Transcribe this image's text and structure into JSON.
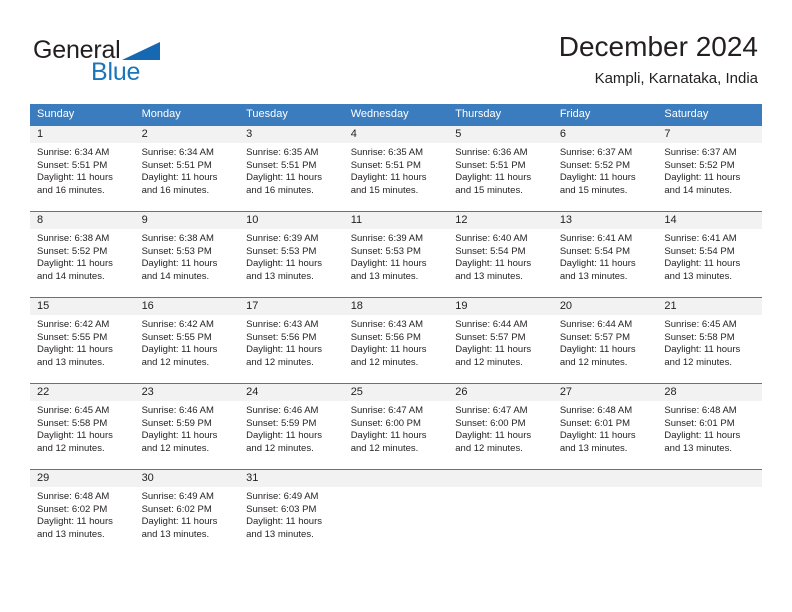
{
  "brand": {
    "word_one": "General",
    "word_two": "Blue",
    "triangle_color": "#1668b3",
    "blue_text_color": "#1b75bb"
  },
  "header": {
    "title": "December 2024",
    "subtitle": "Kampli, Karnataka, India"
  },
  "theme": {
    "header_row_bg": "#3a7cbe",
    "header_row_text": "#ffffff",
    "day_band_bg": "#f2f2f2",
    "cell_text": "#231f20"
  },
  "weekday_headers": [
    "Sunday",
    "Monday",
    "Tuesday",
    "Wednesday",
    "Thursday",
    "Friday",
    "Saturday"
  ],
  "weeks": [
    {
      "days": [
        {
          "date": "1",
          "sunrise": "Sunrise: 6:34 AM",
          "sunset": "Sunset: 5:51 PM",
          "daylight_line1": "Daylight: 11 hours",
          "daylight_line2": "and 16 minutes."
        },
        {
          "date": "2",
          "sunrise": "Sunrise: 6:34 AM",
          "sunset": "Sunset: 5:51 PM",
          "daylight_line1": "Daylight: 11 hours",
          "daylight_line2": "and 16 minutes."
        },
        {
          "date": "3",
          "sunrise": "Sunrise: 6:35 AM",
          "sunset": "Sunset: 5:51 PM",
          "daylight_line1": "Daylight: 11 hours",
          "daylight_line2": "and 16 minutes."
        },
        {
          "date": "4",
          "sunrise": "Sunrise: 6:35 AM",
          "sunset": "Sunset: 5:51 PM",
          "daylight_line1": "Daylight: 11 hours",
          "daylight_line2": "and 15 minutes."
        },
        {
          "date": "5",
          "sunrise": "Sunrise: 6:36 AM",
          "sunset": "Sunset: 5:51 PM",
          "daylight_line1": "Daylight: 11 hours",
          "daylight_line2": "and 15 minutes."
        },
        {
          "date": "6",
          "sunrise": "Sunrise: 6:37 AM",
          "sunset": "Sunset: 5:52 PM",
          "daylight_line1": "Daylight: 11 hours",
          "daylight_line2": "and 15 minutes."
        },
        {
          "date": "7",
          "sunrise": "Sunrise: 6:37 AM",
          "sunset": "Sunset: 5:52 PM",
          "daylight_line1": "Daylight: 11 hours",
          "daylight_line2": "and 14 minutes."
        }
      ]
    },
    {
      "days": [
        {
          "date": "8",
          "sunrise": "Sunrise: 6:38 AM",
          "sunset": "Sunset: 5:52 PM",
          "daylight_line1": "Daylight: 11 hours",
          "daylight_line2": "and 14 minutes."
        },
        {
          "date": "9",
          "sunrise": "Sunrise: 6:38 AM",
          "sunset": "Sunset: 5:53 PM",
          "daylight_line1": "Daylight: 11 hours",
          "daylight_line2": "and 14 minutes."
        },
        {
          "date": "10",
          "sunrise": "Sunrise: 6:39 AM",
          "sunset": "Sunset: 5:53 PM",
          "daylight_line1": "Daylight: 11 hours",
          "daylight_line2": "and 13 minutes."
        },
        {
          "date": "11",
          "sunrise": "Sunrise: 6:39 AM",
          "sunset": "Sunset: 5:53 PM",
          "daylight_line1": "Daylight: 11 hours",
          "daylight_line2": "and 13 minutes."
        },
        {
          "date": "12",
          "sunrise": "Sunrise: 6:40 AM",
          "sunset": "Sunset: 5:54 PM",
          "daylight_line1": "Daylight: 11 hours",
          "daylight_line2": "and 13 minutes."
        },
        {
          "date": "13",
          "sunrise": "Sunrise: 6:41 AM",
          "sunset": "Sunset: 5:54 PM",
          "daylight_line1": "Daylight: 11 hours",
          "daylight_line2": "and 13 minutes."
        },
        {
          "date": "14",
          "sunrise": "Sunrise: 6:41 AM",
          "sunset": "Sunset: 5:54 PM",
          "daylight_line1": "Daylight: 11 hours",
          "daylight_line2": "and 13 minutes."
        }
      ]
    },
    {
      "days": [
        {
          "date": "15",
          "sunrise": "Sunrise: 6:42 AM",
          "sunset": "Sunset: 5:55 PM",
          "daylight_line1": "Daylight: 11 hours",
          "daylight_line2": "and 13 minutes."
        },
        {
          "date": "16",
          "sunrise": "Sunrise: 6:42 AM",
          "sunset": "Sunset: 5:55 PM",
          "daylight_line1": "Daylight: 11 hours",
          "daylight_line2": "and 12 minutes."
        },
        {
          "date": "17",
          "sunrise": "Sunrise: 6:43 AM",
          "sunset": "Sunset: 5:56 PM",
          "daylight_line1": "Daylight: 11 hours",
          "daylight_line2": "and 12 minutes."
        },
        {
          "date": "18",
          "sunrise": "Sunrise: 6:43 AM",
          "sunset": "Sunset: 5:56 PM",
          "daylight_line1": "Daylight: 11 hours",
          "daylight_line2": "and 12 minutes."
        },
        {
          "date": "19",
          "sunrise": "Sunrise: 6:44 AM",
          "sunset": "Sunset: 5:57 PM",
          "daylight_line1": "Daylight: 11 hours",
          "daylight_line2": "and 12 minutes."
        },
        {
          "date": "20",
          "sunrise": "Sunrise: 6:44 AM",
          "sunset": "Sunset: 5:57 PM",
          "daylight_line1": "Daylight: 11 hours",
          "daylight_line2": "and 12 minutes."
        },
        {
          "date": "21",
          "sunrise": "Sunrise: 6:45 AM",
          "sunset": "Sunset: 5:58 PM",
          "daylight_line1": "Daylight: 11 hours",
          "daylight_line2": "and 12 minutes."
        }
      ]
    },
    {
      "days": [
        {
          "date": "22",
          "sunrise": "Sunrise: 6:45 AM",
          "sunset": "Sunset: 5:58 PM",
          "daylight_line1": "Daylight: 11 hours",
          "daylight_line2": "and 12 minutes."
        },
        {
          "date": "23",
          "sunrise": "Sunrise: 6:46 AM",
          "sunset": "Sunset: 5:59 PM",
          "daylight_line1": "Daylight: 11 hours",
          "daylight_line2": "and 12 minutes."
        },
        {
          "date": "24",
          "sunrise": "Sunrise: 6:46 AM",
          "sunset": "Sunset: 5:59 PM",
          "daylight_line1": "Daylight: 11 hours",
          "daylight_line2": "and 12 minutes."
        },
        {
          "date": "25",
          "sunrise": "Sunrise: 6:47 AM",
          "sunset": "Sunset: 6:00 PM",
          "daylight_line1": "Daylight: 11 hours",
          "daylight_line2": "and 12 minutes."
        },
        {
          "date": "26",
          "sunrise": "Sunrise: 6:47 AM",
          "sunset": "Sunset: 6:00 PM",
          "daylight_line1": "Daylight: 11 hours",
          "daylight_line2": "and 12 minutes."
        },
        {
          "date": "27",
          "sunrise": "Sunrise: 6:48 AM",
          "sunset": "Sunset: 6:01 PM",
          "daylight_line1": "Daylight: 11 hours",
          "daylight_line2": "and 13 minutes."
        },
        {
          "date": "28",
          "sunrise": "Sunrise: 6:48 AM",
          "sunset": "Sunset: 6:01 PM",
          "daylight_line1": "Daylight: 11 hours",
          "daylight_line2": "and 13 minutes."
        }
      ]
    },
    {
      "days": [
        {
          "date": "29",
          "sunrise": "Sunrise: 6:48 AM",
          "sunset": "Sunset: 6:02 PM",
          "daylight_line1": "Daylight: 11 hours",
          "daylight_line2": "and 13 minutes."
        },
        {
          "date": "30",
          "sunrise": "Sunrise: 6:49 AM",
          "sunset": "Sunset: 6:02 PM",
          "daylight_line1": "Daylight: 11 hours",
          "daylight_line2": "and 13 minutes."
        },
        {
          "date": "31",
          "sunrise": "Sunrise: 6:49 AM",
          "sunset": "Sunset: 6:03 PM",
          "daylight_line1": "Daylight: 11 hours",
          "daylight_line2": "and 13 minutes."
        },
        {
          "date": "",
          "sunrise": "",
          "sunset": "",
          "daylight_line1": "",
          "daylight_line2": ""
        },
        {
          "date": "",
          "sunrise": "",
          "sunset": "",
          "daylight_line1": "",
          "daylight_line2": ""
        },
        {
          "date": "",
          "sunrise": "",
          "sunset": "",
          "daylight_line1": "",
          "daylight_line2": ""
        },
        {
          "date": "",
          "sunrise": "",
          "sunset": "",
          "daylight_line1": "",
          "daylight_line2": ""
        }
      ]
    }
  ]
}
